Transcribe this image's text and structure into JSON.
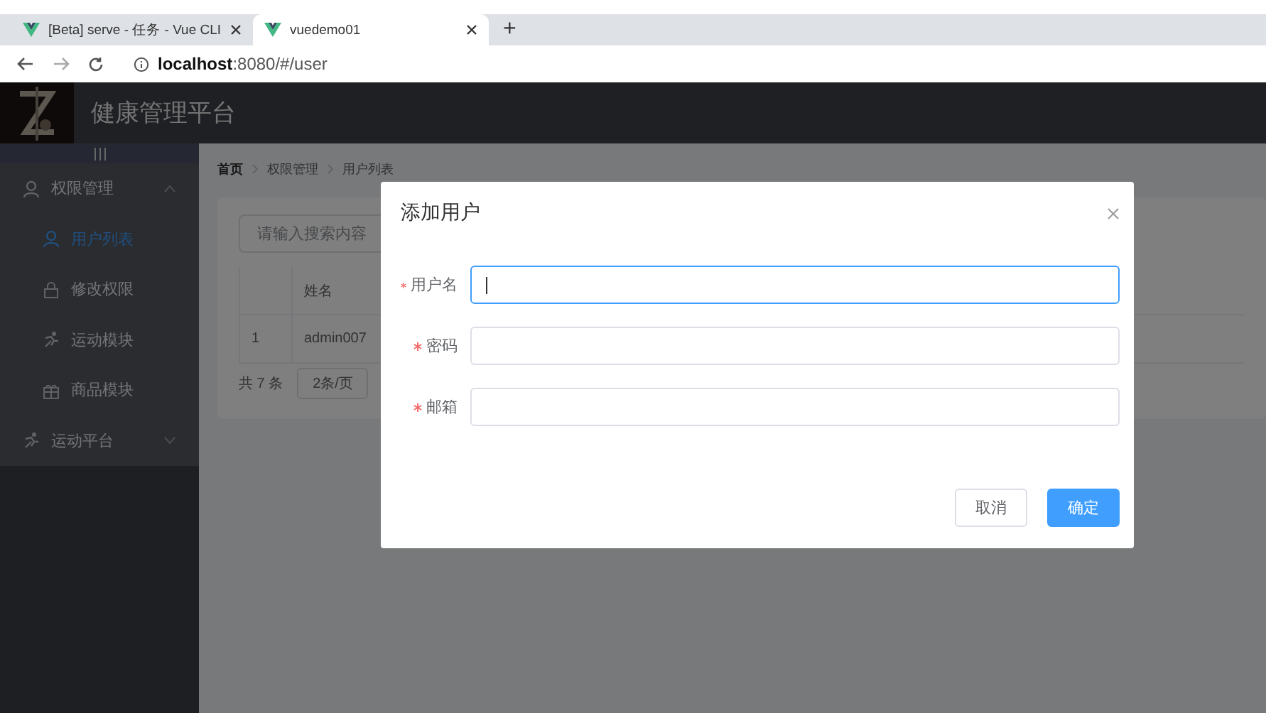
{
  "browser": {
    "tabs": [
      {
        "title": "[Beta] serve - 任务 - Vue CLI",
        "selected": false
      },
      {
        "title": "vuedemo01",
        "selected": true
      }
    ],
    "new_tab": "+",
    "url": "**localhost**:8080/#/user"
  },
  "header": {
    "title": "健康管理平台"
  },
  "sidebar": {
    "items": [
      {
        "label": "权限管理",
        "kind": "user",
        "expanded": true,
        "selected": false,
        "children": [
          {
            "label": "用户列表",
            "kind": "user",
            "selected": true
          },
          {
            "label": "修改权限",
            "kind": "lock",
            "selected": false
          },
          {
            "label": "运动模块",
            "kind": "run",
            "selected": false
          },
          {
            "label": "商品模块",
            "kind": "gift",
            "selected": false
          }
        ]
      },
      {
        "label": "运动平台",
        "kind": "run",
        "expanded": false,
        "selected": false
      }
    ]
  },
  "breadcrumb": [
    "首页",
    "权限管理",
    "用户列表"
  ],
  "card": {
    "search": {
      "placeholder": "请输入搜索内容"
    },
    "table": {
      "columns": [
        "",
        "姓名"
      ],
      "rows": [
        [
          "1",
          "admin007"
        ]
      ]
    },
    "pagination": {
      "total": "共 7 条",
      "page_size": "2条/页"
    }
  },
  "dialog": {
    "title": "添加用户",
    "fields": [
      {
        "label": "用户名",
        "required": true,
        "focused": true
      },
      {
        "label": "密码",
        "required": true,
        "focused": false
      },
      {
        "label": "邮箱",
        "required": true,
        "focused": false
      }
    ],
    "buttons": [
      {
        "label": "取消",
        "kind": "default"
      },
      {
        "label": "确定",
        "kind": "primary"
      }
    ]
  }
}
